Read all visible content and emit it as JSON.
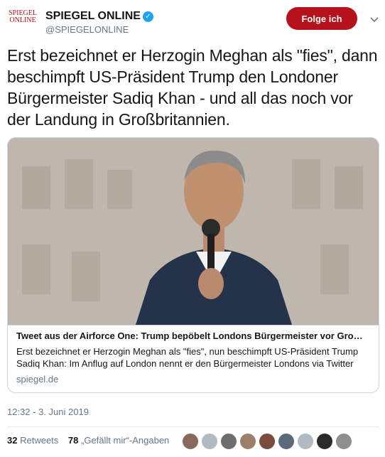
{
  "account": {
    "logo_line1": "SPIEGEL",
    "logo_line2": "ONLINE",
    "name": "SPIEGEL ONLINE",
    "handle": "@SPIEGELONLINE",
    "follow_label": "Folge ich"
  },
  "tweet": {
    "text": "Erst bezeichnet er Herzogin Meghan als \"fies\", dann beschimpft US-Präsident Trump den Londoner Bürgermeister Sadiq Khan - und all das noch vor der Landung in Großbritannien.",
    "timestamp": "12:32 - 3. Juni 2019"
  },
  "card": {
    "title": "Tweet aus der Airforce One: Trump bepöbelt Londons Bürgermeister vor Gro…",
    "description": "Erst bezeichnet er Herzogin Meghan als \"fies\", nun beschimpft US-Präsident Trump Sadiq Khan: Im Anflug auf London nennt er  den Bürgermeister Londons via Twitter",
    "domain": "spiegel.de"
  },
  "stats": {
    "retweets_count": "32",
    "retweets_label": "Retweets",
    "likes_count": "78",
    "likes_label": "„Gefällt mir“-Angaben"
  },
  "colors": {
    "brand": "#b5121b",
    "verified": "#1da1f2"
  }
}
